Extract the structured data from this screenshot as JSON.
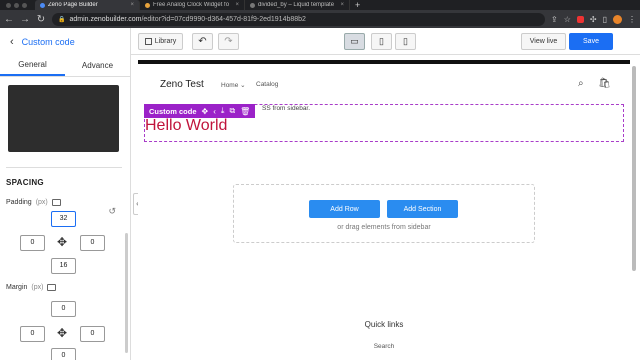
{
  "browser": {
    "tabs": [
      {
        "title": "Zeno Page Builder",
        "active": true
      },
      {
        "title": "Free Analog Clock Widget fo",
        "active": false
      },
      {
        "title": "divided_by – Liquid template",
        "active": false
      }
    ],
    "new_tab": "+",
    "url_host": "admin.zenobuilder.com",
    "url_path": "/editor?id=07cd9990-d364-457d-81f9-2ed1914b88b2"
  },
  "left_panel": {
    "back_icon": "‹",
    "title": "Custom code",
    "tabs": [
      "General",
      "Advance"
    ],
    "spacing": {
      "title": "SPACING",
      "padding_label": "Padding",
      "padding_unit": "(px)",
      "padding": {
        "top": "32",
        "left": "0",
        "right": "0",
        "bottom": "16"
      },
      "margin_label": "Margin",
      "margin_unit": "(px)",
      "margin": {
        "top": "0",
        "left": "0",
        "right": "0",
        "bottom": "0"
      }
    }
  },
  "toolbar": {
    "library_label": "Library",
    "view_live_label": "View live",
    "save_label": "Save",
    "active_device": "desktop"
  },
  "canvas": {
    "site_logo": "Zeno Test",
    "nav_home": "Home ⌄",
    "nav_catalog": "Catalog",
    "custom_code_label": "Custom code",
    "custom_code_hint": "SS from sidebar.",
    "hello_text": "Hello World",
    "add_row_label": "Add Row",
    "add_section_label": "Add Section",
    "drag_hint": "or drag elements from sidebar",
    "footer_title": "Quick links",
    "footer_link": "Search"
  },
  "colors": {
    "accent": "#1b6ef3",
    "selection": "#9b22c8",
    "hello_text": "#c0143c"
  }
}
